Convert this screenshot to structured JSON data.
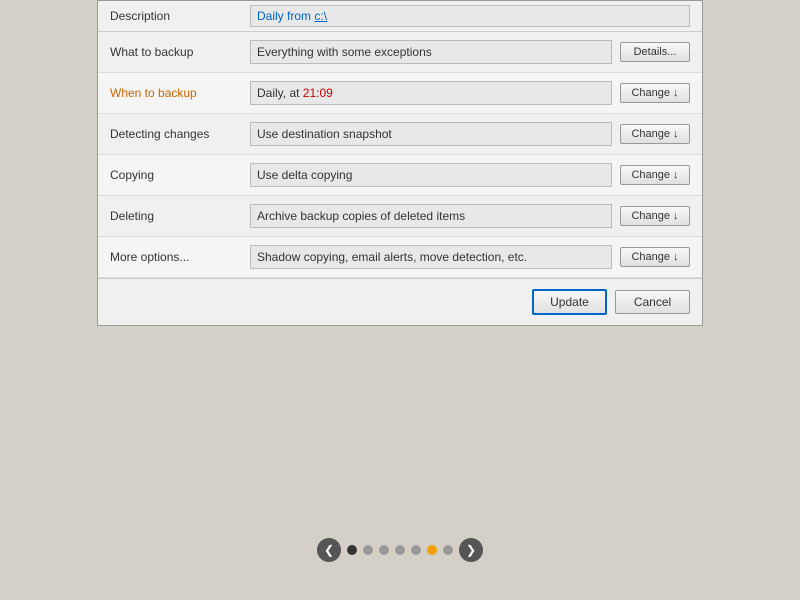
{
  "description": {
    "label": "Description",
    "value": "Daily from c:\\",
    "value_prefix": "Daily from ",
    "value_link": "c:\\"
  },
  "rows": [
    {
      "id": "what-to-backup",
      "label": "What to backup",
      "highlight": false,
      "value": "Everything with some exceptions",
      "time_part": null,
      "button": "Details..."
    },
    {
      "id": "when-to-backup",
      "label": "When to backup",
      "highlight": true,
      "value": "Daily, at ",
      "time_part": "21:09",
      "button": "Change ↓"
    },
    {
      "id": "detecting-changes",
      "label": "Detecting changes",
      "highlight": false,
      "value": "Use destination snapshot",
      "time_part": null,
      "button": "Change ↓"
    },
    {
      "id": "copying",
      "label": "Copying",
      "highlight": false,
      "value": "Use delta copying",
      "time_part": null,
      "button": "Change ↓"
    },
    {
      "id": "deleting",
      "label": "Deleting",
      "highlight": false,
      "value": "Archive backup copies of deleted items",
      "time_part": null,
      "button": "Change ↓"
    },
    {
      "id": "more-options",
      "label": "More options...",
      "highlight": false,
      "value": "Shadow copying, email alerts, move detection, etc.",
      "time_part": null,
      "button": "Change ↓"
    }
  ],
  "footer": {
    "update_label": "Update",
    "cancel_label": "Cancel"
  },
  "pagination": {
    "prev_label": "❮",
    "next_label": "❯",
    "dots": 7,
    "active_dot": 0
  }
}
